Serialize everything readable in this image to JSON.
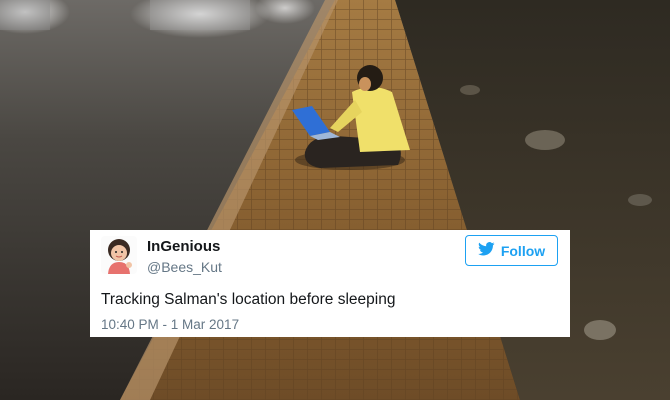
{
  "tweet": {
    "display_name": "InGenious",
    "handle": "@Bees_Kut",
    "follow_label": "Follow",
    "text": "Tracking Salman's location before sleeping",
    "timestamp": "10:40 PM - 1 Mar 2017",
    "avatar_icon": "cartoon-avatar-icon",
    "follow_icon": "twitter-bird-icon"
  },
  "colors": {
    "twitter_blue": "#1da1f2",
    "secondary_text": "#657786",
    "primary_text": "#14171a",
    "card_background": "#ffffff"
  }
}
